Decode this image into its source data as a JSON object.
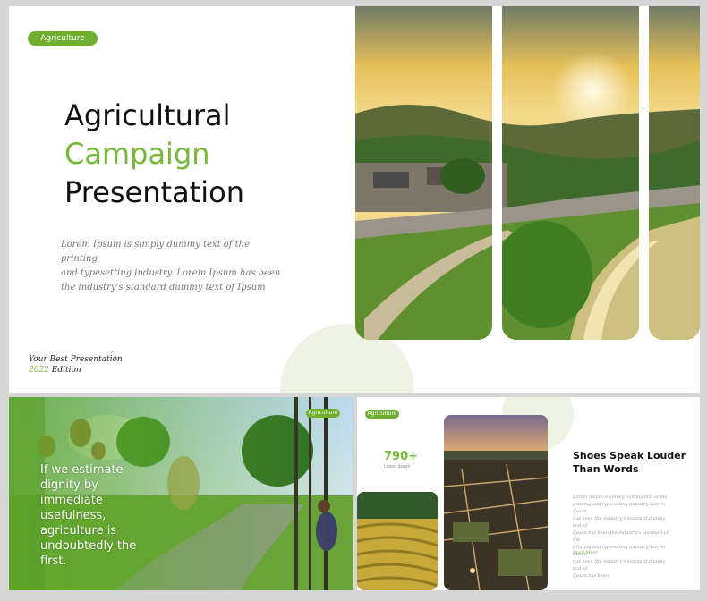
{
  "main_slide": {
    "tag": "Agriculture",
    "title_line1": "Agricultural",
    "title_line2": "Campaign",
    "title_line3": "Presentation",
    "body_line1": "Lorem Ipsum is simply dummy text of the printing",
    "body_line2": "and typesetting industry. Lorem Ipsum has been",
    "body_line3": "the industry's standard dummy text of Ipsum",
    "edition_line1": "Your Best Presentation",
    "edition_year": "2022",
    "edition_word": "Edition"
  },
  "slide_left": {
    "tag": "Agriculture",
    "quote_line1": "If we estimate",
    "quote_line2": "dignity by",
    "quote_line3": "immediate",
    "quote_line4": "usefulness,",
    "quote_line5": "agriculture is",
    "quote_line6": "undoubtedly the",
    "quote_line7": "first."
  },
  "slide_right": {
    "tag": "Agriculture",
    "stat_value": "790+",
    "stat_label": "Lorem Ipsum",
    "heading_line1": "Shoes Speak Louder",
    "heading_line2": "Than Words",
    "body_lines": [
      "Lorem Ipsum is simply dummy text of the",
      "printing and typesetting industry. Lorem Ipsum",
      "has been the industry's standard dummy text of",
      "Ipsum has been the industry's standard of the",
      "printing and typesetting industry. Lorem Ipsum",
      "has been the industry's standard dummy text of",
      "Ipsum has been."
    ],
    "read_more": "Read More"
  },
  "colors": {
    "accent": "#76b83b",
    "pill": "#6fae2e",
    "circle": "#eef3e3"
  }
}
